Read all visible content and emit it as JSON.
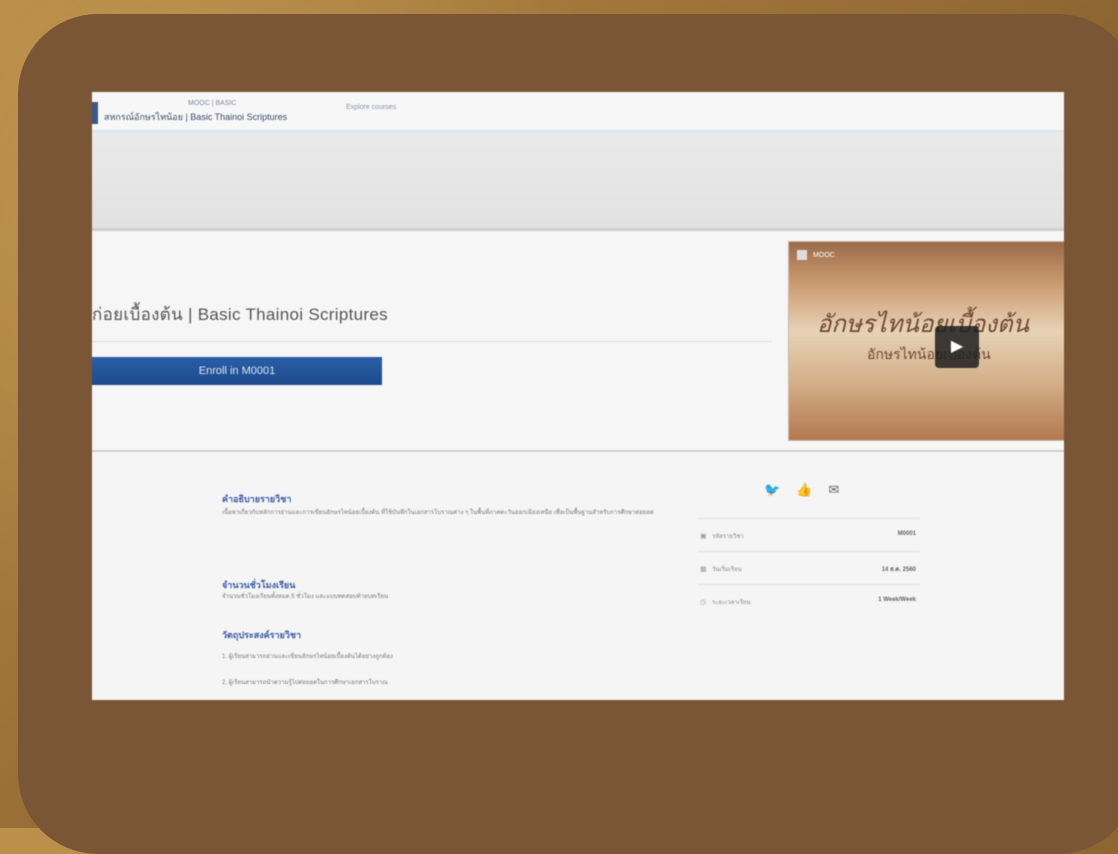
{
  "header": {
    "site_title": "สหกรณ์อักษรไทน้อย | Basic Thainoi Scriptures",
    "small_text": "MOOC | BASIC",
    "nav_link": "Explore courses"
  },
  "course": {
    "title": "ก่อยเบื้องต้น | Basic Thainoi Scriptures",
    "enroll_label": "Enroll in M0001"
  },
  "video": {
    "channel": "MOOC",
    "script_text": "อักษรไทน้อยเบื้องต้น",
    "subtitle": "อักษรไทน้อยเบื้องต้น",
    "play_icon": "▶"
  },
  "share": {
    "twitter": "🐦",
    "facebook": "👍",
    "email": "✉"
  },
  "sections": [
    {
      "heading": "คำอธิบายรายวิชา",
      "text": "เนื้อหาเกี่ยวกับหลักการอ่านและการเขียนอักษรไทน้อยเบื้องต้น ที่ใช้บันทึกในเอกสารโบราณต่าง ๆ ในพื้นที่ภาคตะวันออกเฉียงเหนือ เพื่อเป็นพื้นฐานสำหรับการศึกษาต่อยอด"
    },
    {
      "heading": "จำนวนชั่วโมงเรียน",
      "text": "จำนวนชั่วโมงเรียนทั้งหมด 5 ชั่วโมง และแบบทดสอบท้ายบทเรียน"
    },
    {
      "heading": "วัตถุประสงค์รายวิชา",
      "text": "1. ผู้เรียนสามารถอ่านและเขียนอักษรไทน้อยเบื้องต้นได้อย่างถูกต้อง"
    },
    {
      "heading": "",
      "text": "2. ผู้เรียนสามารถนำความรู้ไปต่อยอดในการศึกษาเอกสารโบราณ"
    }
  ],
  "info": [
    {
      "icon": "▣",
      "label": "รหัสรายวิชา",
      "value": "M0001"
    },
    {
      "icon": "▦",
      "label": "วันเริ่มเรียน",
      "value": "14 ส.ค. 2560"
    },
    {
      "icon": "◷",
      "label": "ระยะเวลาเรียน",
      "value": "1 Week/Week"
    }
  ]
}
